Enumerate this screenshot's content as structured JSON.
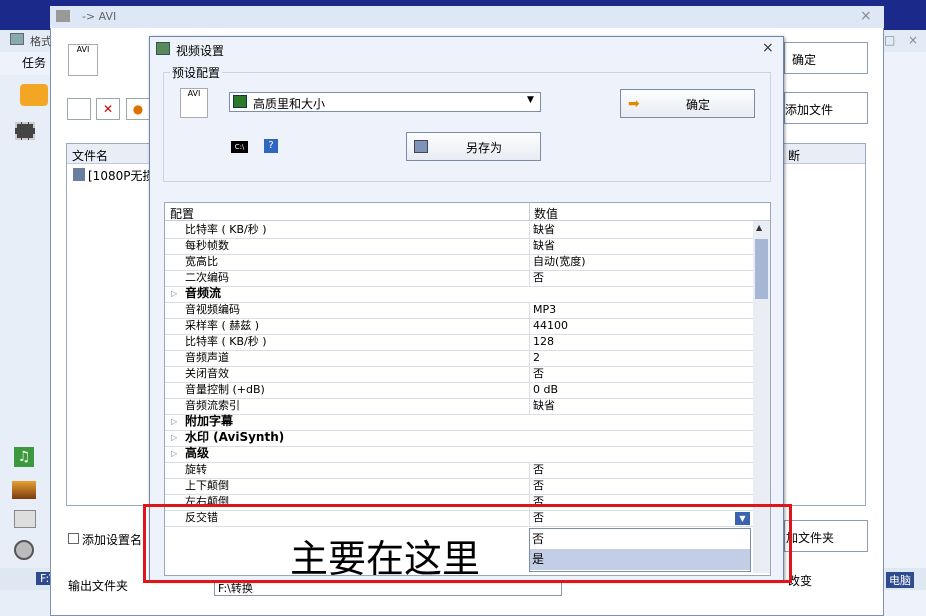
{
  "bg_app": {
    "title": "格式",
    "menu": "任务",
    "bottom_drive": "F:\\",
    "right_bottom": "电脑",
    "right_top_btn": "确定",
    "add_file_btn": "添加文件",
    "add_folder_btn": "加文件夹",
    "change_btn": "改变"
  },
  "avi_window": {
    "title": "-> AVI",
    "list_header_name": "文件名",
    "list_header_right": "断",
    "file_item": "[1080P无损",
    "add_setting_label": "添加设置名",
    "output_folder_label": "输出文件夹",
    "output_path": "F:\\转换"
  },
  "dialog": {
    "title": "视频设置",
    "close": "×",
    "preset_label": "预设配置",
    "preset_value": "高质里和大小",
    "ok_label": "确定",
    "save_as_label": "另存为",
    "grid": {
      "col_key": "配置",
      "col_value": "数值",
      "rows": [
        {
          "k": "比特率 ( KB/秒 )",
          "v": "缺省"
        },
        {
          "k": "每秒帧数",
          "v": "缺省"
        },
        {
          "k": "宽高比",
          "v": "自动(宽度)"
        },
        {
          "k": "二次编码",
          "v": "否"
        },
        {
          "cat": "音频流"
        },
        {
          "k": "音视频编码",
          "v": "MP3"
        },
        {
          "k": "采样率 ( 赫兹 )",
          "v": "44100"
        },
        {
          "k": "比特率 ( KB/秒 )",
          "v": "128"
        },
        {
          "k": "音频声道",
          "v": "2"
        },
        {
          "k": "关闭音效",
          "v": "否"
        },
        {
          "k": "音量控制 (+dB)",
          "v": "0 dB"
        },
        {
          "k": "音频流索引",
          "v": "缺省"
        },
        {
          "cat": "附加字幕"
        },
        {
          "cat": "水印 (AviSynth)"
        },
        {
          "cat": "高级"
        },
        {
          "k": "旋转",
          "v": "否"
        },
        {
          "k": "上下颠倒",
          "v": "否"
        },
        {
          "k": "左右颠倒",
          "v": "否"
        },
        {
          "k": "反交错",
          "v": "否"
        }
      ]
    },
    "dropdown_options": [
      "否",
      "是"
    ]
  },
  "annotation": "主要在这里",
  "colors": {
    "annotation_border": "#e0151a",
    "selected_option": "#c4cde6"
  }
}
